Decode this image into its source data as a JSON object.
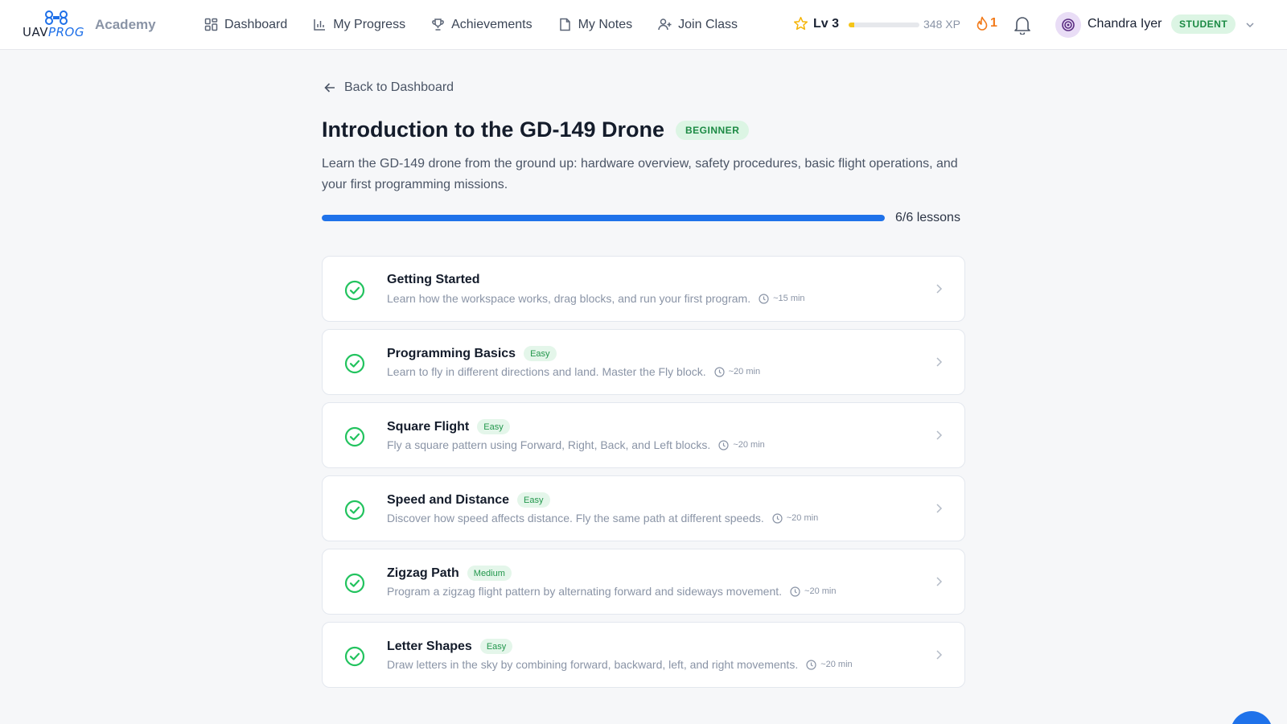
{
  "header": {
    "logo_part1": "UAV",
    "logo_part2": "PROG",
    "academy": "Academy",
    "nav": [
      {
        "label": "Dashboard",
        "icon": "grid-icon"
      },
      {
        "label": "My Progress",
        "icon": "bar-chart-icon"
      },
      {
        "label": "Achievements",
        "icon": "trophy-icon"
      },
      {
        "label": "My Notes",
        "icon": "note-icon"
      },
      {
        "label": "Join Class",
        "icon": "user-plus-icon"
      }
    ],
    "level": "Lv 3",
    "xp_progress": 0.08,
    "xp": "348 XP",
    "streak": "1",
    "user_name": "Chandra Iyer",
    "role": "STUDENT"
  },
  "course": {
    "back_label": "Back to Dashboard",
    "title": "Introduction to the GD-149 Drone",
    "level_badge": "BEGINNER",
    "description": "Learn the GD-149 drone from the ground up: hardware overview, safety procedures, basic flight operations, and your first programming missions.",
    "progress": 1.0,
    "progress_label": "6/6 lessons"
  },
  "lessons": [
    {
      "title": "Getting Started",
      "difficulty": "",
      "description": "Learn how the workspace works, drag blocks, and run your first program.",
      "duration": "~15 min"
    },
    {
      "title": "Programming Basics",
      "difficulty": "Easy",
      "description": "Learn to fly in different directions and land. Master the Fly block.",
      "duration": "~20 min"
    },
    {
      "title": "Square Flight",
      "difficulty": "Easy",
      "description": "Fly a square pattern using Forward, Right, Back, and Left blocks.",
      "duration": "~20 min"
    },
    {
      "title": "Speed and Distance",
      "difficulty": "Easy",
      "description": "Discover how speed affects distance. Fly the same path at different speeds.",
      "duration": "~20 min"
    },
    {
      "title": "Zigzag Path",
      "difficulty": "Medium",
      "description": "Program a zigzag flight pattern by alternating forward and sideways movement.",
      "duration": "~20 min"
    },
    {
      "title": "Letter Shapes",
      "difficulty": "Easy",
      "description": "Draw letters in the sky by combining forward, backward, left, and right movements.",
      "duration": "~20 min"
    }
  ],
  "colors": {
    "accent": "#1f72ea",
    "success": "#22c35e",
    "xp": "#f5c518",
    "streak": "#f27a1a"
  }
}
